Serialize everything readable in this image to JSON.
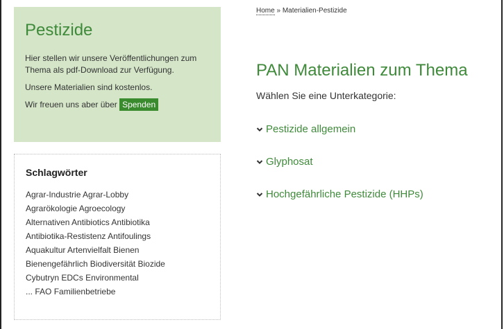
{
  "sidebar": {
    "promo": {
      "title": "Pestizide",
      "text1": "Hier stellen wir unsere Veröffentlichungen zum Thema als pdf-Download zur Verfügung.",
      "text2": "Unsere Materialien sind kostenlos.",
      "text3_prefix": "Wir freuen uns aber über",
      "donate_label": "Spenden"
    },
    "tags": {
      "heading": "Schlagwörter",
      "lines": [
        [
          "Agrar-Industrie",
          "Agrar-Lobby"
        ],
        [
          "Agrarökologie",
          "Agroecology"
        ],
        [
          "Alternativen",
          "Antibiotics",
          "Antibiotika"
        ],
        [
          "Antibiotika-Restistenz",
          "Antifoulings"
        ],
        [
          "Aquakultur",
          "Artenvielfalt",
          "Bienen"
        ],
        [
          "Bienengefährlich",
          "Biodiversität",
          "Biozide"
        ],
        [
          "Cybutryn",
          "EDCs",
          "Environmental"
        ],
        [
          "...",
          "FAO",
          "Familienbetriebe"
        ]
      ]
    }
  },
  "breadcrumb": {
    "home": "Home",
    "separator": " » ",
    "current": "Materialien-Pestizide"
  },
  "main": {
    "title": "PAN Materialien zum Thema",
    "subtitle": "Wählen Sie eine Unterkategorie:",
    "categories": [
      {
        "label": "Pestizide allgemein",
        "icon": "chevron-down-icon"
      },
      {
        "label": "Glyphosat",
        "icon": "chevron-down-icon"
      },
      {
        "label": "Hochgefährliche Pestizide (HHPs)",
        "icon": "chevron-down-icon"
      }
    ]
  },
  "colors": {
    "green": "#3f8a3a",
    "promo_bg": "#d4e5c8",
    "donate_bg": "#3a8a2e"
  }
}
